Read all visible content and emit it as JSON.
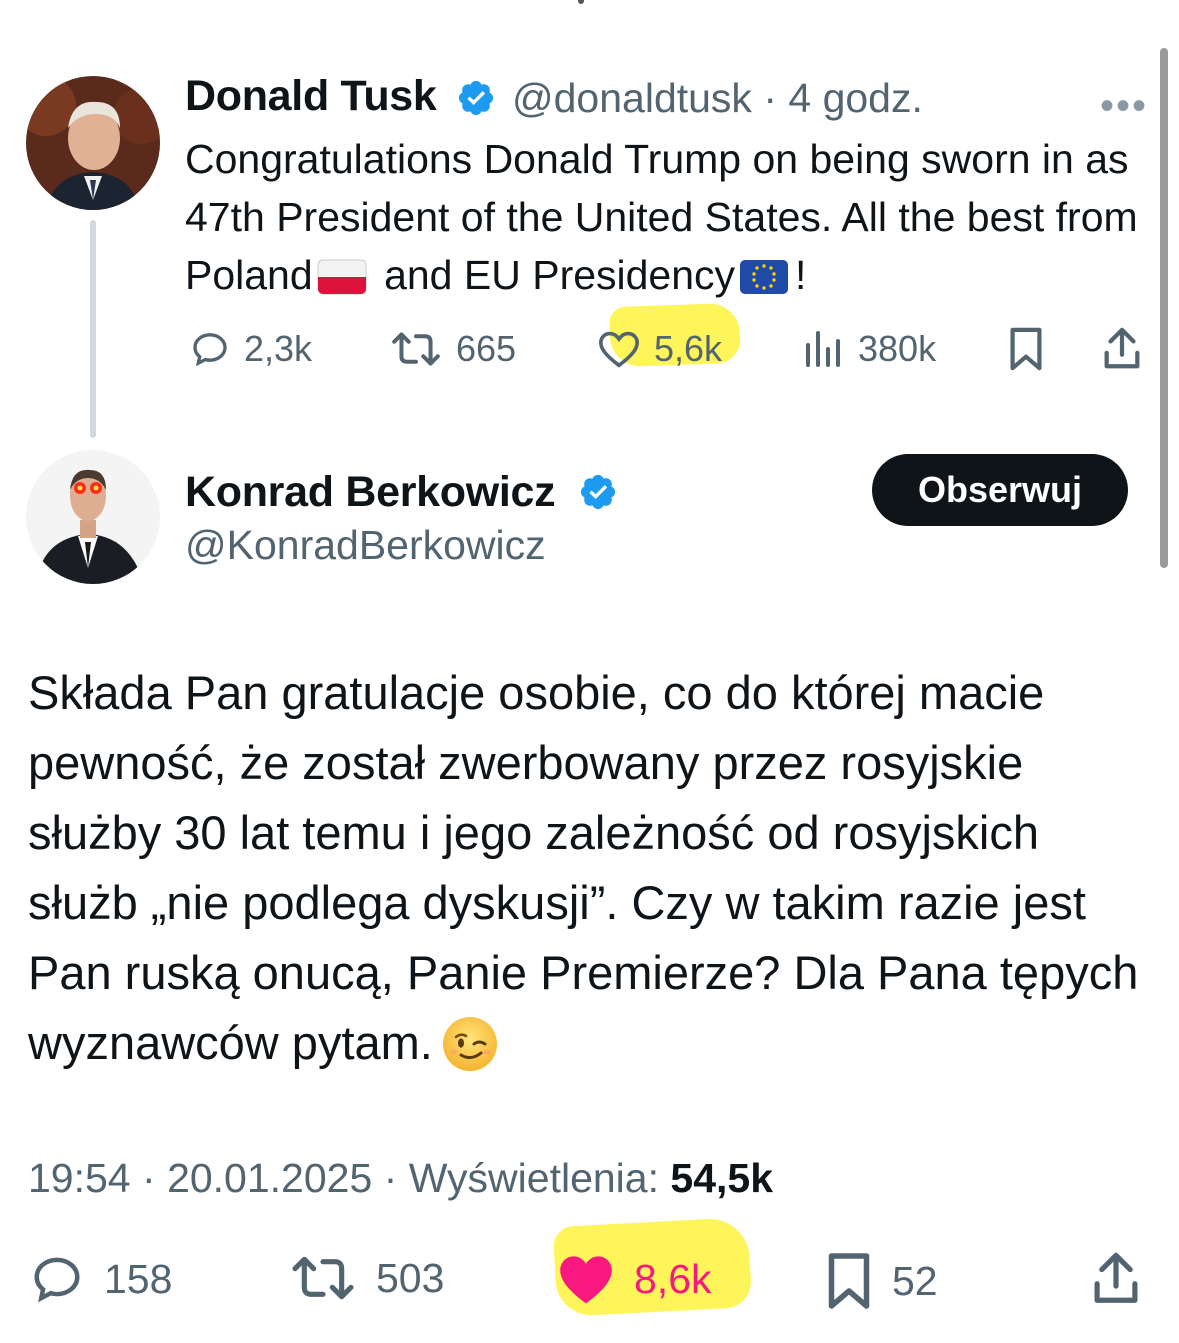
{
  "parent_tweet": {
    "author_name": "Donald Tusk",
    "handle": "@donaldtusk",
    "time": "· 4 godz.",
    "more_icon": "more-horizontal-icon",
    "text_part1": "Congratulations Donald Trump on being sworn in as 47th President of the United States. All the best from Poland",
    "text_part2": "and EU Presidency",
    "text_part3": "!",
    "stats": {
      "replies": "2,3k",
      "retweets": "665",
      "likes": "5,6k",
      "views": "380k"
    }
  },
  "reply_tweet": {
    "author_name": "Konrad Berkowicz",
    "handle": "@KonradBerkowicz",
    "follow_label": "Obserwuj",
    "text": "Składa Pan gratulacje osobie, co do której macie pewność, że został zwerbowany przez rosyjskie służby 30 lat temu i jego zależność od rosyjskich służb „nie podlega dyskusji”. Czy w takim razie jest Pan ruską onucą, Panie Premierze? Dla Pana tępych wyznawców pytam.",
    "time": "19:54",
    "date": "20.01.2025",
    "views_label": "Wyświetlenia:",
    "views": "54,5k",
    "stats": {
      "replies": "158",
      "retweets": "503",
      "likes": "8,6k",
      "bookmarks": "52"
    }
  },
  "colors": {
    "verified": "#1d9bf0",
    "like_active": "#f91880",
    "highlight": "#fdf55a",
    "muted": "#536471"
  }
}
